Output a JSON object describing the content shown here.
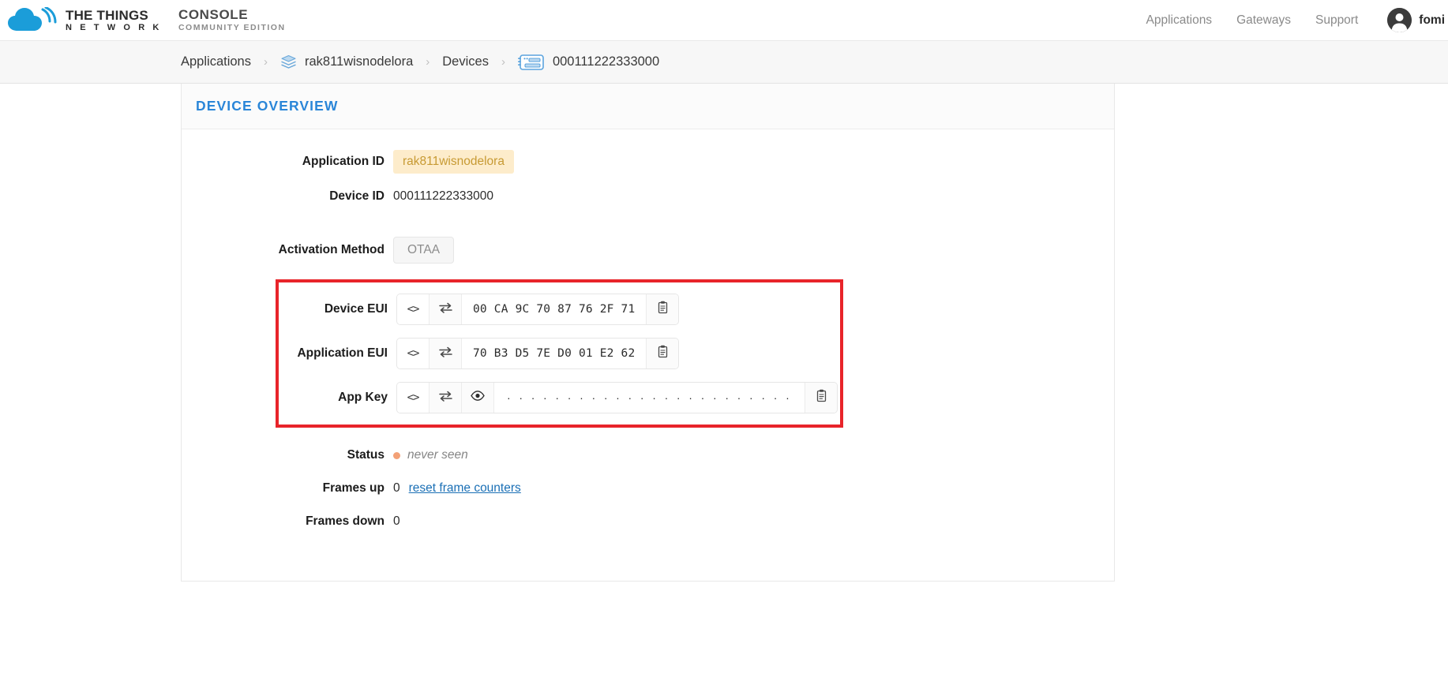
{
  "brand": {
    "ttn_line1": "THE THINGS",
    "ttn_line2": "N E T W O R K",
    "console_line1": "CONSOLE",
    "console_line2": "COMMUNITY EDITION",
    "logo_icon": "cloud-icon"
  },
  "nav": {
    "links": [
      {
        "label": "Applications",
        "name": "nav-applications"
      },
      {
        "label": "Gateways",
        "name": "nav-gateways"
      },
      {
        "label": "Support",
        "name": "nav-support"
      }
    ],
    "user": {
      "name": "fomi",
      "avatar_icon": "user-avatar-icon"
    }
  },
  "breadcrumb": {
    "separator": "›",
    "items": [
      {
        "label": "Applications",
        "icon": null
      },
      {
        "label": "rak811wisnodelora",
        "icon": "layers-icon"
      },
      {
        "label": "Devices",
        "icon": null
      },
      {
        "label": "000111222333000",
        "icon": "device-chip-icon"
      }
    ]
  },
  "card": {
    "title": "DEVICE OVERVIEW",
    "fields": {
      "application_id": {
        "label": "Application ID",
        "value": "rak811wisnodelora"
      },
      "device_id": {
        "label": "Device ID",
        "value": "000111222333000"
      },
      "activation_method": {
        "label": "Activation Method",
        "value": "OTAA"
      },
      "device_eui": {
        "label": "Device EUI",
        "value": "00 CA 9C 70 87 76 2F 71",
        "code_btn": "<>",
        "swap_icon": "byte-order-swap-icon",
        "copy_icon": "clipboard-copy-icon"
      },
      "application_eui": {
        "label": "Application EUI",
        "value": "70 B3 D5 7E D0 01 E2 62",
        "code_btn": "<>",
        "swap_icon": "byte-order-swap-icon",
        "copy_icon": "clipboard-copy-icon"
      },
      "app_key": {
        "label": "App Key",
        "value": "· · · · · · · · · · · · · · · · · · · · · · · ·",
        "code_btn": "<>",
        "swap_icon": "byte-order-swap-icon",
        "reveal_icon": "eye-icon",
        "copy_icon": "clipboard-copy-icon"
      },
      "status": {
        "label": "Status",
        "value": "never seen",
        "dot_color": "#f3a177"
      },
      "frames_up": {
        "label": "Frames up",
        "value": "0",
        "link": "reset frame counters"
      },
      "frames_down": {
        "label": "Frames down",
        "value": "0"
      }
    }
  },
  "colors": {
    "accent_blue": "#2a86d8",
    "badge_bg": "#fdeccb",
    "badge_text": "#c79a33",
    "highlight_red": "#e8242a",
    "link_blue": "#1a6fb5"
  }
}
